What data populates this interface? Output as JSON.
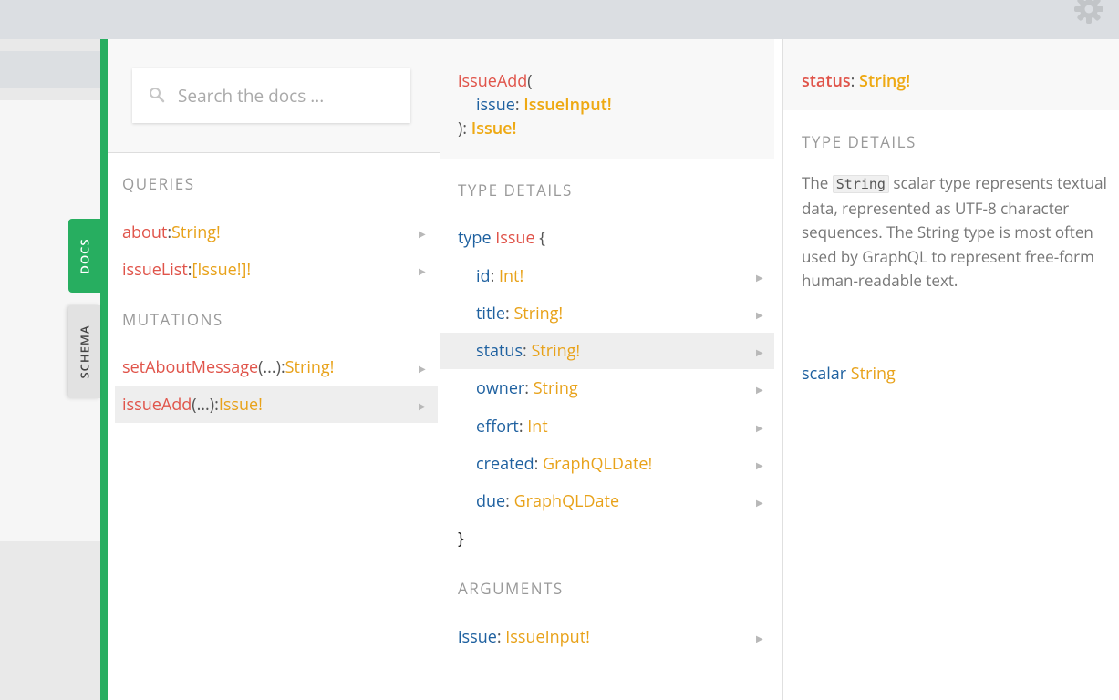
{
  "search": {
    "placeholder": "Search the docs ..."
  },
  "tabs": {
    "docs": "DOCS",
    "schema": "SCHEMA"
  },
  "queries": {
    "title": "QUERIES",
    "items": [
      {
        "name": "about",
        "sep": ": ",
        "type": "String!"
      },
      {
        "name": "issueList",
        "sep": ": ",
        "type": "[Issue!]!"
      }
    ]
  },
  "mutations": {
    "title": "MUTATIONS",
    "items": [
      {
        "name": "setAboutMessage",
        "args": "(...)",
        "sep": ": ",
        "type": "String!"
      },
      {
        "name": "issueAdd",
        "args": "(...)",
        "sep": ": ",
        "type": "Issue!"
      }
    ]
  },
  "field_panel": {
    "signature": {
      "name": "issueAdd",
      "open": "(",
      "arg_name": "issue",
      "arg_sep": ": ",
      "arg_type": "IssueInput!",
      "close": "): ",
      "return_type": "Issue!"
    },
    "type_details_title": "TYPE DETAILS",
    "type_kw": "type",
    "type_name": "Issue",
    "open_brace": "{",
    "close_brace": "}",
    "fields": [
      {
        "name": "id",
        "type": "Int!"
      },
      {
        "name": "title",
        "type": "String!"
      },
      {
        "name": "status",
        "type": "String!"
      },
      {
        "name": "owner",
        "type": "String"
      },
      {
        "name": "effort",
        "type": "Int"
      },
      {
        "name": "created",
        "type": "GraphQLDate!"
      },
      {
        "name": "due",
        "type": "GraphQLDate"
      }
    ],
    "arguments_title": "ARGUMENTS",
    "argument": {
      "name": "issue",
      "type": "IssueInput!"
    }
  },
  "type_panel": {
    "field_name": "status",
    "field_sep": ": ",
    "field_type": "String!",
    "type_details_title": "TYPE DETAILS",
    "desc_prefix": "The ",
    "desc_code": "String",
    "desc_suffix": " scalar type represents textual data, represented as UTF-8 character sequences. The String type is most often used by GraphQL to represent free-form human-readable text.",
    "scalar_kw": "scalar",
    "scalar_name": "String"
  },
  "colors": {
    "accent": "#27ae60",
    "field_name": "#e0544a",
    "type_name": "#e8a21a",
    "keyword": "#1f61a0"
  }
}
